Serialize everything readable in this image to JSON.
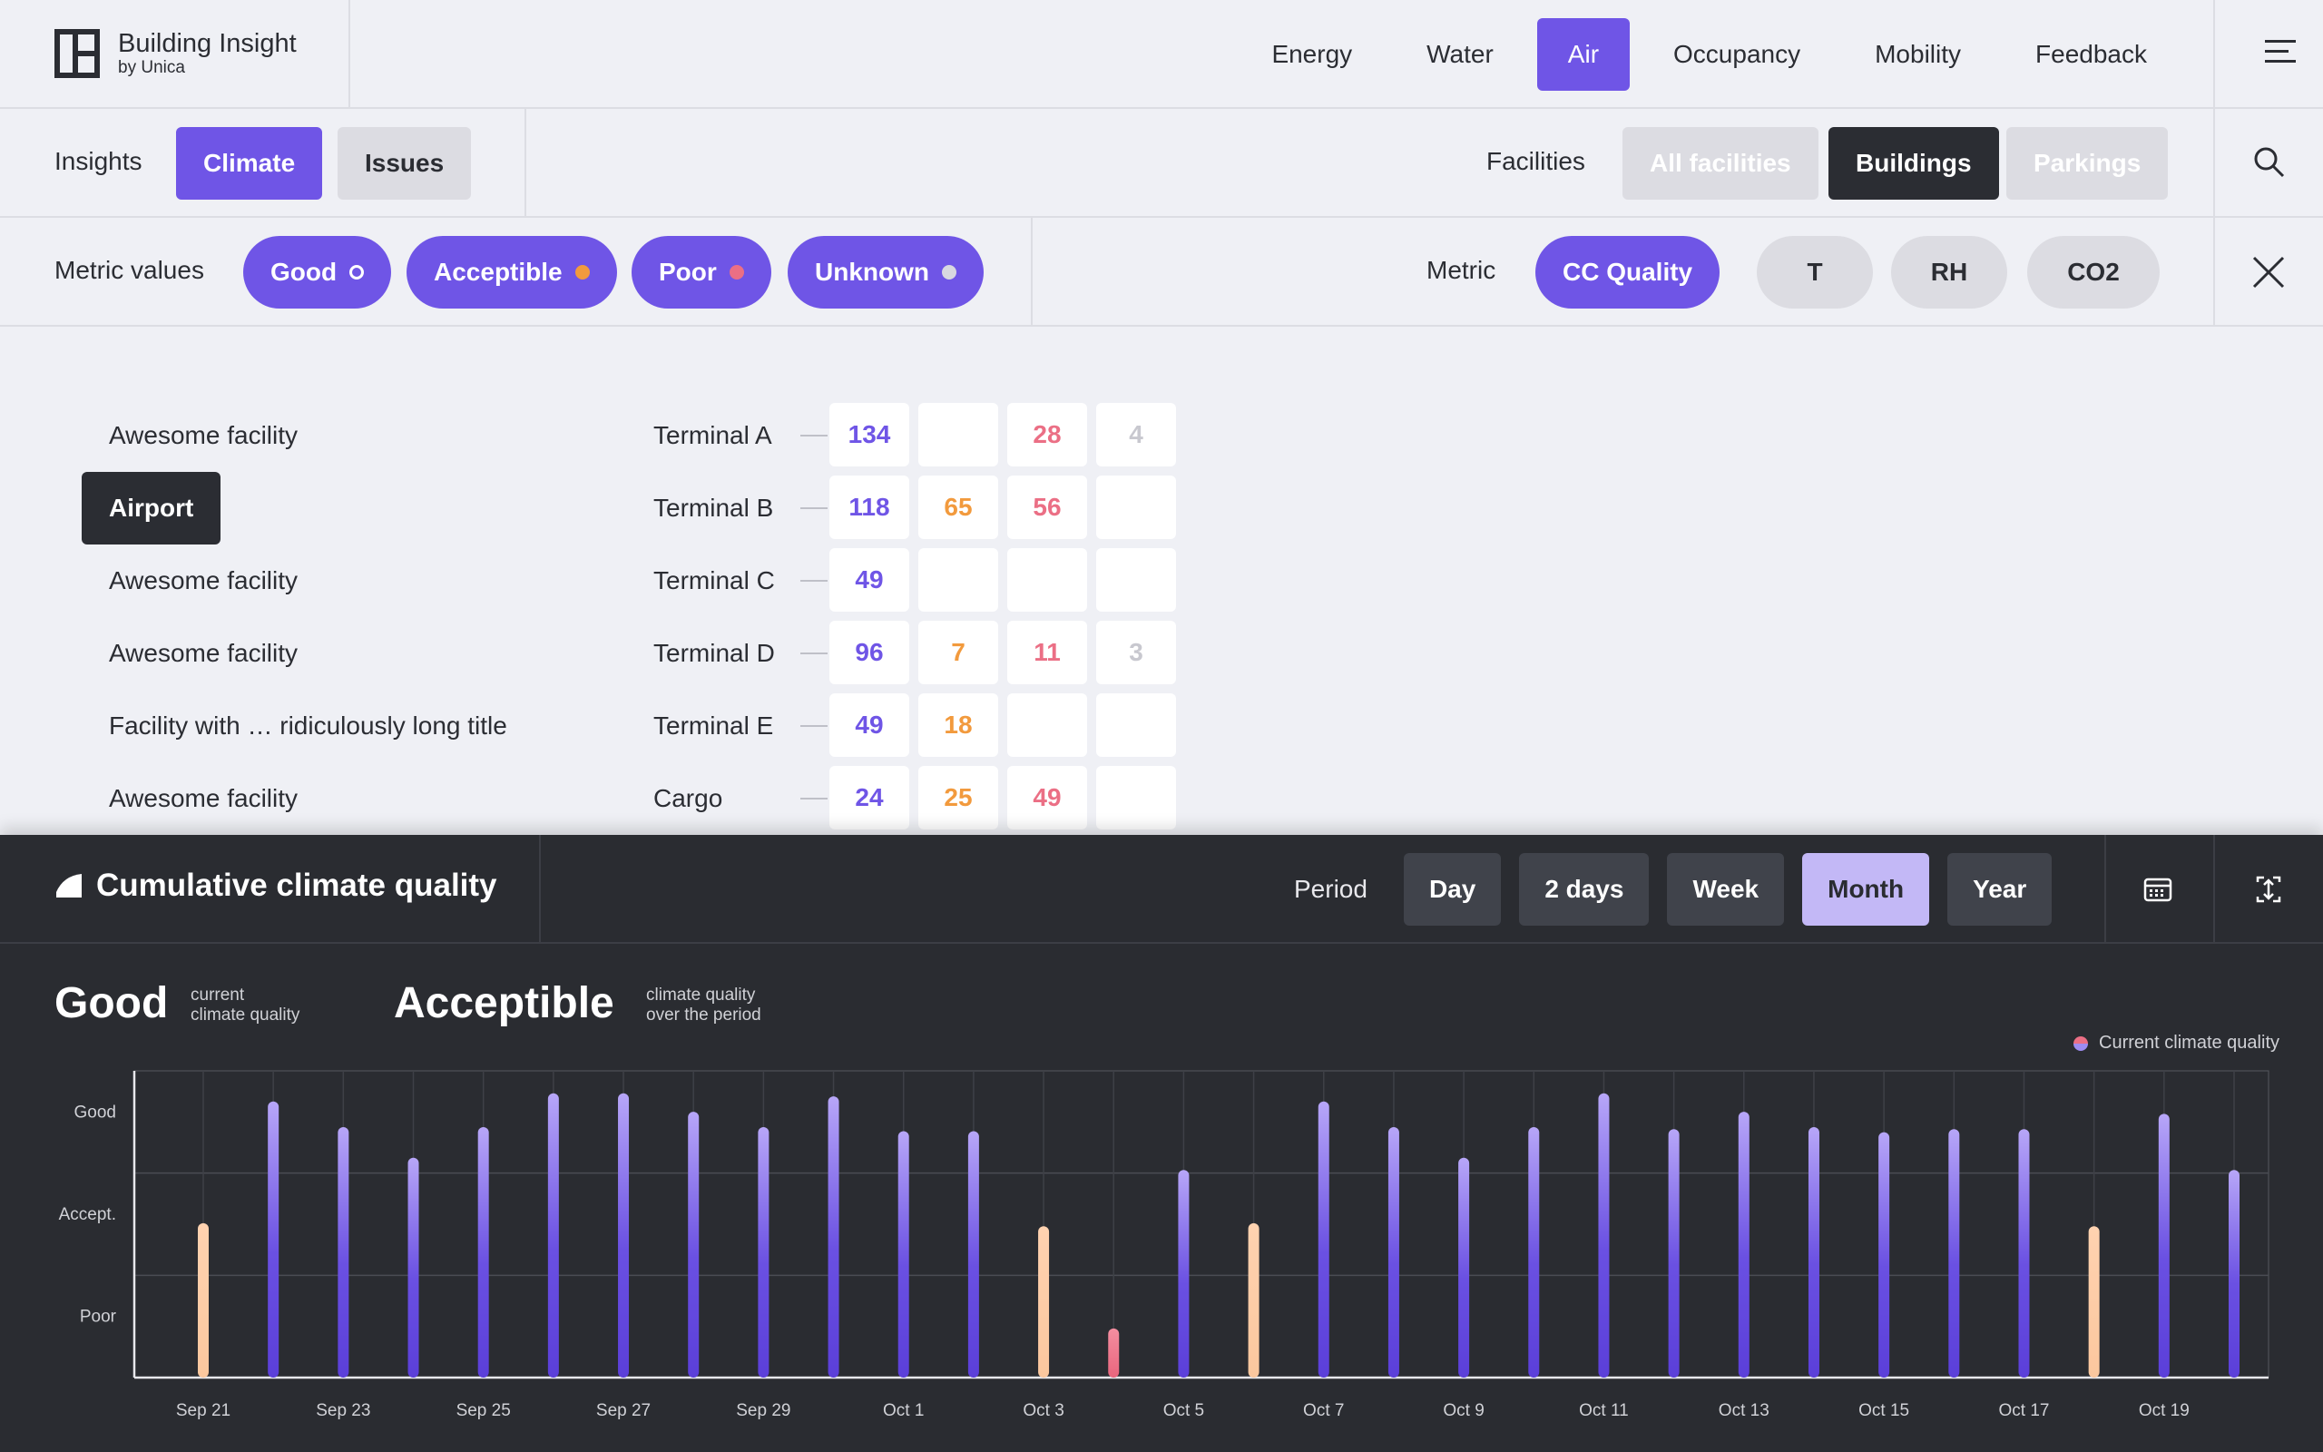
{
  "app": {
    "title": "Building Insight",
    "subtitle": "by Unica"
  },
  "nav": {
    "items": [
      "Energy",
      "Water",
      "Air",
      "Occupancy",
      "Mobility",
      "Feedback"
    ],
    "active": "Air"
  },
  "row2": {
    "insights_label": "Insights",
    "climate": "Climate",
    "issues": "Issues",
    "facilities_label": "Facilities",
    "all_facilities": "All facilities",
    "buildings": "Buildings",
    "parkings": "Parkings"
  },
  "row3": {
    "metric_values_label": "Metric values",
    "values": [
      "Good",
      "Acceptible",
      "Poor",
      "Unknown"
    ],
    "metric_label": "Metric",
    "metrics": [
      "CC Quality",
      "T",
      "RH",
      "CO2"
    ],
    "active_metric": "CC Quality"
  },
  "facilities": [
    "Awesome facility",
    "Airport",
    "Awesome facility",
    "Awesome facility",
    "Facility with … ridiculously long title",
    "Awesome facility"
  ],
  "selected_facility": "Airport",
  "terminals": [
    {
      "name": "Terminal A",
      "good": "134",
      "acc": "",
      "poor": "28",
      "unk": "4"
    },
    {
      "name": "Terminal B",
      "good": "118",
      "acc": "65",
      "poor": "56",
      "unk": ""
    },
    {
      "name": "Terminal C",
      "good": "49",
      "acc": "",
      "poor": "",
      "unk": ""
    },
    {
      "name": "Terminal D",
      "good": "96",
      "acc": "7",
      "poor": "11",
      "unk": "3"
    },
    {
      "name": "Terminal E",
      "good": "49",
      "acc": "18",
      "poor": "",
      "unk": ""
    },
    {
      "name": "Cargo",
      "good": "24",
      "acc": "25",
      "poor": "49",
      "unk": ""
    }
  ],
  "panel": {
    "title": "Cumulative climate quality",
    "period_label": "Period",
    "periods": [
      "Day",
      "2 days",
      "Week",
      "Month",
      "Year"
    ],
    "active_period": "Month",
    "current_value": "Good",
    "current_caption": [
      "current",
      "climate quality"
    ],
    "period_value": "Acceptible",
    "period_caption": [
      "climate quality",
      "over the period"
    ],
    "legend": "Current climate quality"
  },
  "colors": {
    "accent": "#6f55e6",
    "acceptable": "#f29a3d",
    "poor": "#eb6f85",
    "dark": "#2a2c31"
  },
  "chart_data": {
    "type": "bar",
    "title": "",
    "y_levels": [
      "Poor",
      "Accept.",
      "Good"
    ],
    "y_tick_labels": [
      "Good",
      "Accept.",
      "Poor"
    ],
    "ylim": [
      0,
      3
    ],
    "x_tick_labels": [
      "Sep 21",
      "Sep 23",
      "Sep 25",
      "Sep 27",
      "Sep 29",
      "Oct 1",
      "Oct 3",
      "Oct 5",
      "Oct 7",
      "Oct 9",
      "Oct 11",
      "Oct 13",
      "Oct 15",
      "Oct 17",
      "Oct 19"
    ],
    "bars": [
      {
        "value": 1.51,
        "level": "Acceptible"
      },
      {
        "value": 2.7,
        "level": "Good"
      },
      {
        "value": 2.45,
        "level": "Good"
      },
      {
        "value": 2.15,
        "level": "Good"
      },
      {
        "value": 2.45,
        "level": "Good"
      },
      {
        "value": 2.78,
        "level": "Good"
      },
      {
        "value": 2.78,
        "level": "Good"
      },
      {
        "value": 2.6,
        "level": "Good"
      },
      {
        "value": 2.45,
        "level": "Good"
      },
      {
        "value": 2.75,
        "level": "Good"
      },
      {
        "value": 2.41,
        "level": "Good"
      },
      {
        "value": 2.41,
        "level": "Good"
      },
      {
        "value": 1.48,
        "level": "Acceptible"
      },
      {
        "value": 0.48,
        "level": "Poor"
      },
      {
        "value": 2.03,
        "level": "Good"
      },
      {
        "value": 1.51,
        "level": "Acceptible"
      },
      {
        "value": 2.7,
        "level": "Good"
      },
      {
        "value": 2.45,
        "level": "Good"
      },
      {
        "value": 2.15,
        "level": "Good"
      },
      {
        "value": 2.45,
        "level": "Good"
      },
      {
        "value": 2.78,
        "level": "Good"
      },
      {
        "value": 2.43,
        "level": "Good"
      },
      {
        "value": 2.6,
        "level": "Good"
      },
      {
        "value": 2.45,
        "level": "Good"
      },
      {
        "value": 2.4,
        "level": "Good"
      },
      {
        "value": 2.43,
        "level": "Good"
      },
      {
        "value": 2.43,
        "level": "Good"
      },
      {
        "value": 1.48,
        "level": "Acceptible"
      },
      {
        "value": 2.58,
        "level": "Good"
      },
      {
        "value": 2.03,
        "level": "Good"
      }
    ],
    "grid": true,
    "legend": "top-right"
  }
}
